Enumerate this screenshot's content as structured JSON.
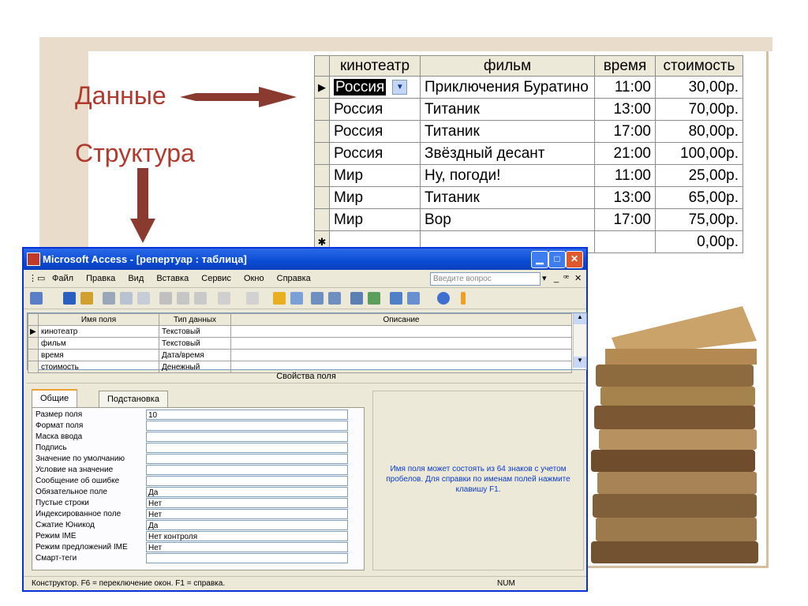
{
  "slide": {
    "label_data": "Данные",
    "label_structure": "Структура"
  },
  "datasheet": {
    "columns": [
      "кинотеатр",
      "фильм",
      "время",
      "стоимость"
    ],
    "rows": [
      [
        "Россия",
        "Приключения Буратино",
        "11:00",
        "30,00р."
      ],
      [
        "Россия",
        "Титаник",
        "13:00",
        "70,00р."
      ],
      [
        "Россия",
        "Титаник",
        "17:00",
        "80,00р."
      ],
      [
        "Россия",
        "Звёздный десант",
        "21:00",
        "100,00р."
      ],
      [
        "Мир",
        "Ну, погоди!",
        "11:00",
        "25,00р."
      ],
      [
        "Мир",
        "Титаник",
        "13:00",
        "65,00р."
      ],
      [
        "Мир",
        "Вор",
        "17:00",
        "75,00р."
      ]
    ],
    "new_row_cost": "0,00р."
  },
  "window": {
    "title": "Microsoft Access - [репертуар : таблица]",
    "menu": [
      "Файл",
      "Правка",
      "Вид",
      "Вставка",
      "Сервис",
      "Окно",
      "Справка"
    ],
    "question_placeholder": "Введите вопрос",
    "design": {
      "columns": [
        "Имя поля",
        "Тип данных",
        "Описание"
      ],
      "rows": [
        {
          "name": "кинотеатр",
          "type": "Текстовый"
        },
        {
          "name": "фильм",
          "type": "Текстовый"
        },
        {
          "name": "время",
          "type": "Дата/время"
        },
        {
          "name": "стоимость",
          "type": "Денежный"
        }
      ]
    },
    "properties_header": "Свойства поля",
    "tabs": [
      "Общие",
      "Подстановка"
    ],
    "properties": [
      {
        "label": "Размер поля",
        "value": "10"
      },
      {
        "label": "Формат поля",
        "value": ""
      },
      {
        "label": "Маска ввода",
        "value": ""
      },
      {
        "label": "Подпись",
        "value": ""
      },
      {
        "label": "Значение по умолчанию",
        "value": ""
      },
      {
        "label": "Условие на значение",
        "value": ""
      },
      {
        "label": "Сообщение об ошибке",
        "value": ""
      },
      {
        "label": "Обязательное поле",
        "value": "Да"
      },
      {
        "label": "Пустые строки",
        "value": "Нет"
      },
      {
        "label": "Индексированное поле",
        "value": "Нет"
      },
      {
        "label": "Сжатие Юникод",
        "value": "Да"
      },
      {
        "label": "Режим IME",
        "value": "Нет контроля"
      },
      {
        "label": "Режим предложений IME",
        "value": "Нет"
      },
      {
        "label": "Смарт-теги",
        "value": ""
      }
    ],
    "help_text": "Имя поля может состоять из 64 знаков с учетом пробелов. Для справки по именам полей нажмите клавишу F1.",
    "status_text": "Конструктор. F6 = переключение окон. F1 = справка.",
    "status_num": "NUM"
  },
  "colors": {
    "label": "#b03a2e",
    "arrow": "#8b3a2f",
    "title_bar": "#0a4bd4",
    "help_text": "#0a3ad1"
  }
}
